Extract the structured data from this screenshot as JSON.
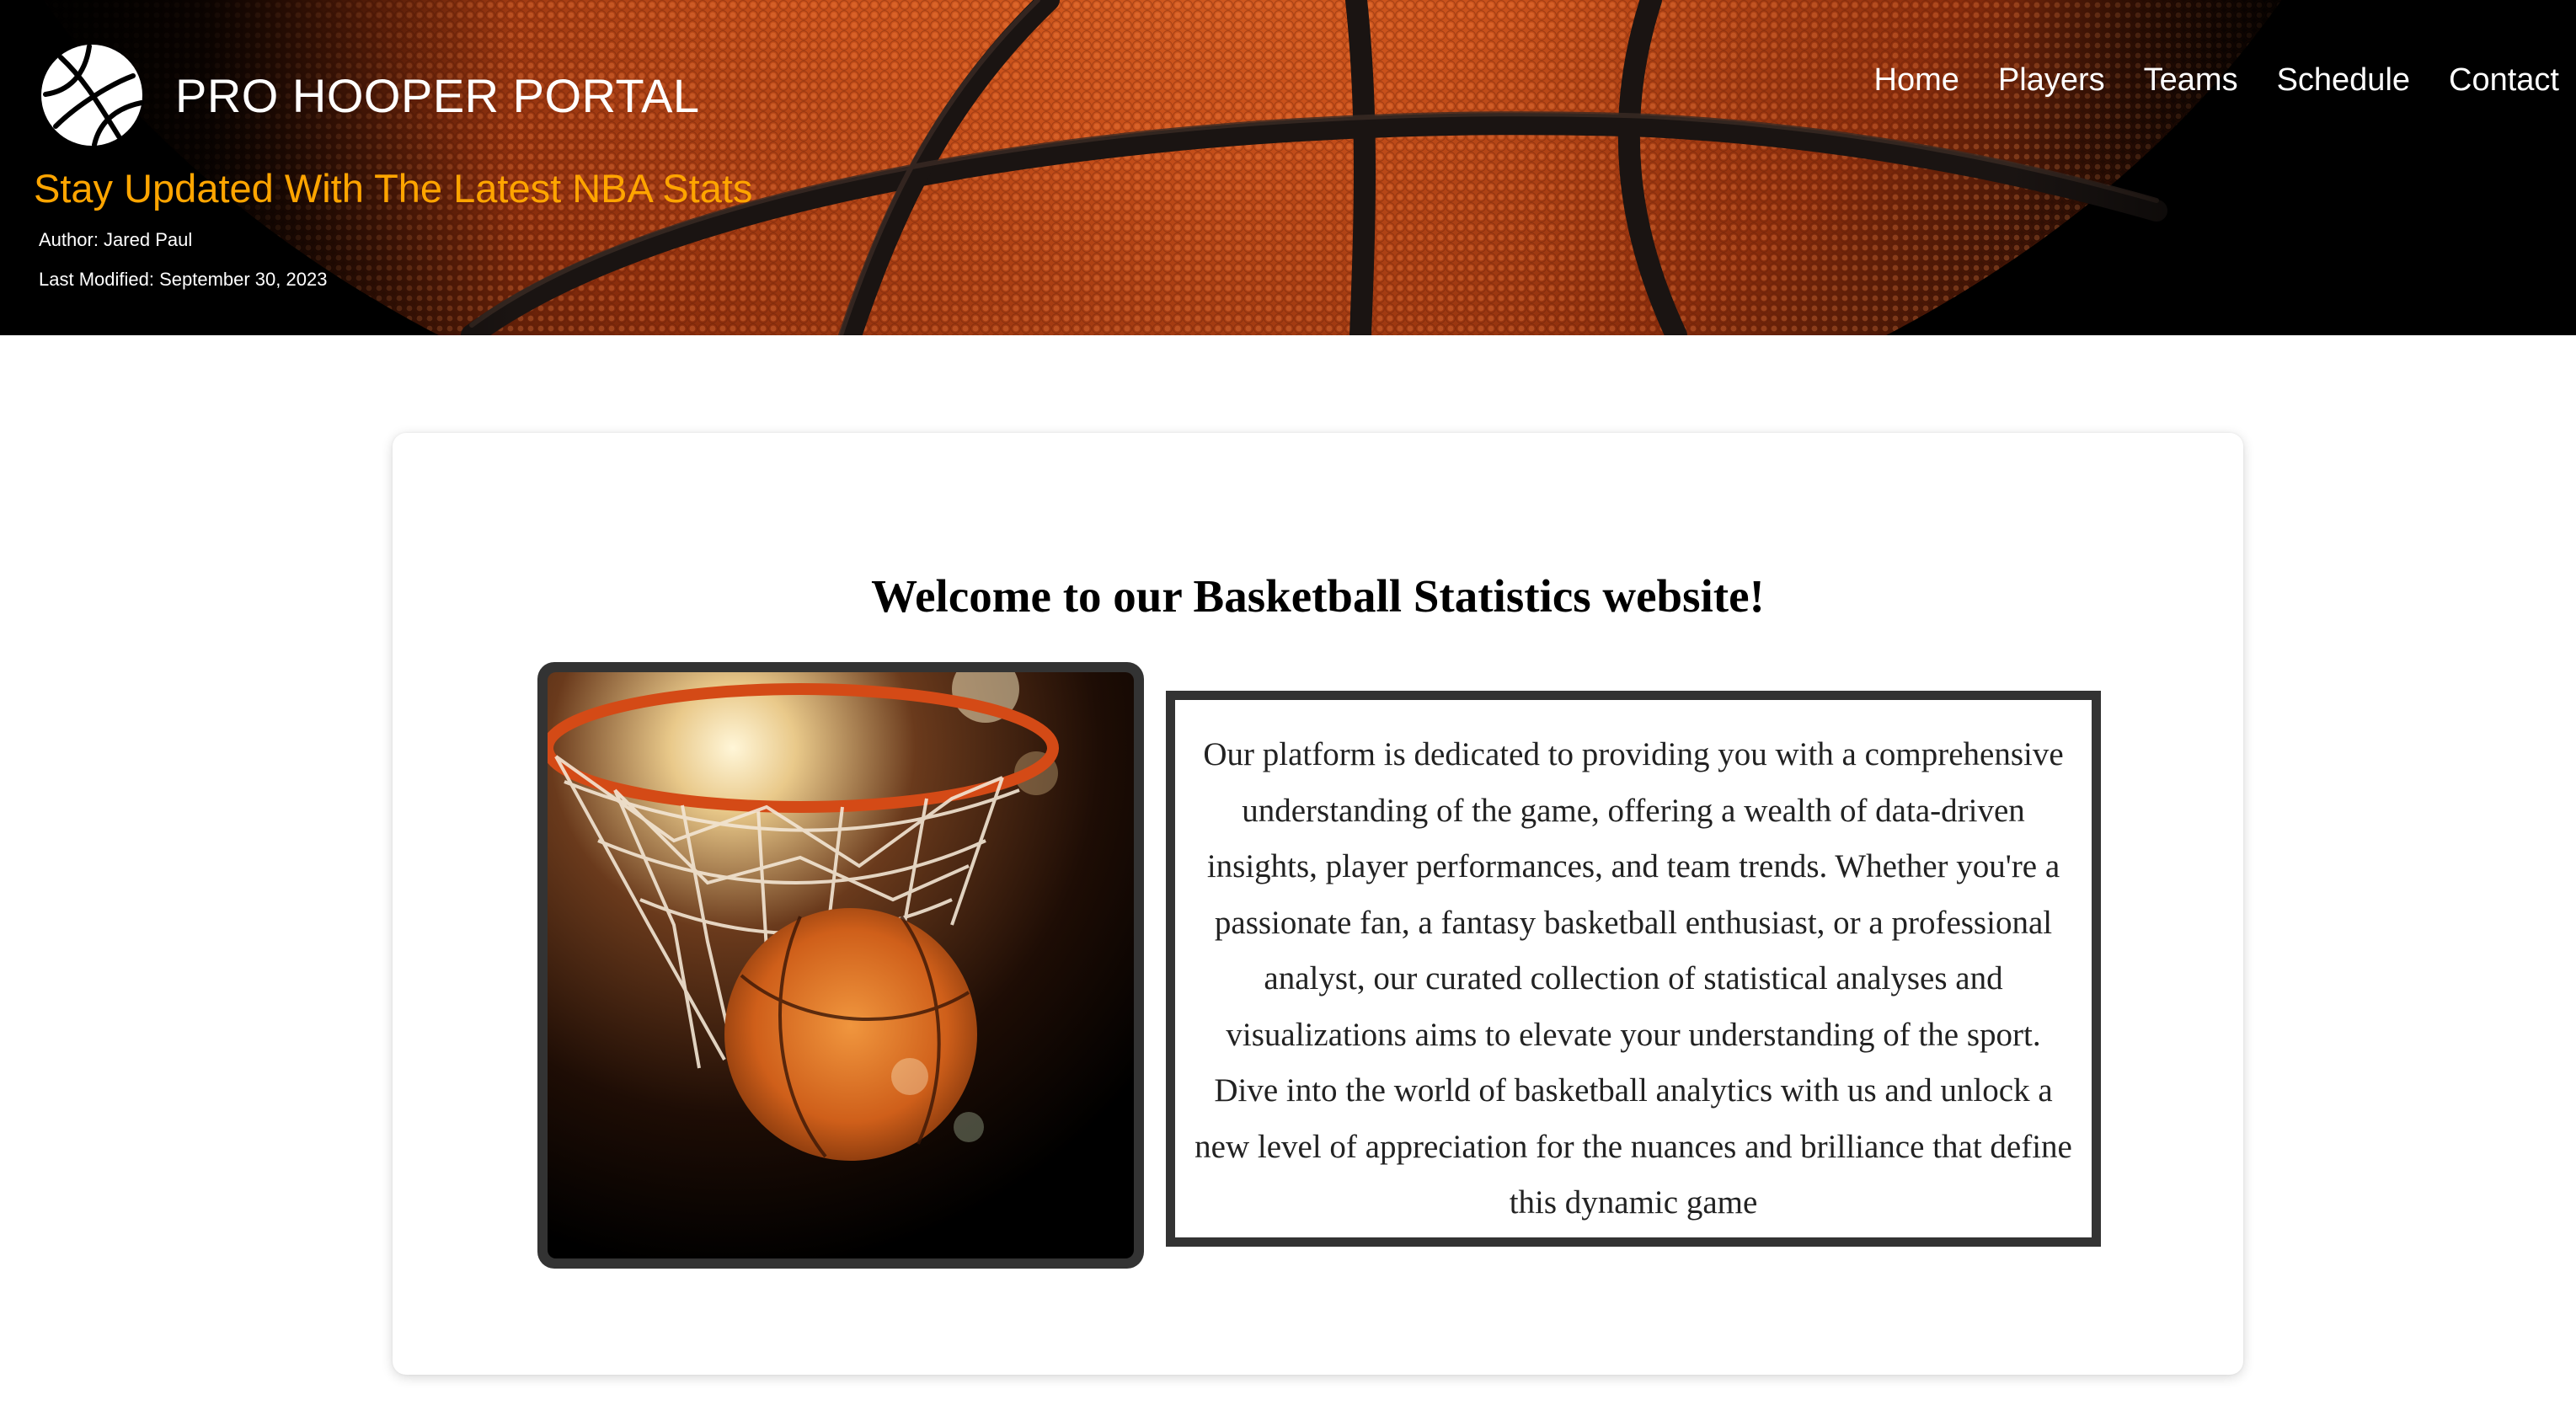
{
  "header": {
    "site_title": "PRO HOOPER PORTAL",
    "logo_icon": "basketball-icon",
    "tagline": "Stay Updated With The Latest NBA Stats",
    "author": "Author: Jared Paul",
    "last_modified": "Last Modified: September 30, 2023",
    "nav": {
      "home": "Home",
      "players": "Players",
      "teams": "Teams",
      "schedule": "Schedule",
      "contact": "Contact"
    }
  },
  "main": {
    "heading": "Welcome to our Basketball Statistics website!",
    "image_subject": "basketball-swishing-through-net",
    "intro": "Our platform is dedicated to providing you with a comprehensive understanding of the game, offering a wealth of data-driven insights, player performances, and team trends. Whether you're a passionate fan, a fantasy basketball enthusiast, or a professional analyst, our curated collection of statistical analyses and visualizations aims to elevate your understanding of the sport. Dive into the world of basketball analytics with us and unlock a new level of appreciation for the nuances and brilliance that define this dynamic game"
  },
  "colors": {
    "tagline": "#ffa500",
    "header_bg": "#000000",
    "frame": "#333333",
    "ball": "#c8501a"
  }
}
